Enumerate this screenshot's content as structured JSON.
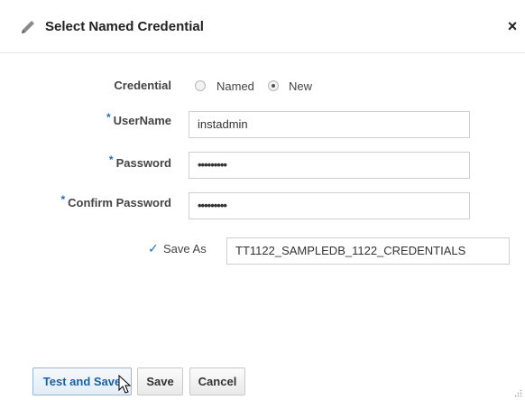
{
  "dialog": {
    "title": "Select Named Credential",
    "close_label": "×"
  },
  "form": {
    "credential": {
      "label": "Credential",
      "options": [
        "Named",
        "New"
      ],
      "selected": "New"
    },
    "username": {
      "label": "UserName",
      "required_mark": "*",
      "value": "instadmin"
    },
    "password": {
      "label": "Password",
      "required_mark": "*",
      "value": "•••••••••"
    },
    "confirm_password": {
      "label": "Confirm Password",
      "required_mark": "*",
      "value": "•••••••••"
    },
    "save_as": {
      "check": "✓",
      "label": "Save As",
      "value": "TT1122_SAMPLEDB_1122_CREDENTIALS"
    }
  },
  "buttons": {
    "test_and_save": "Test and Save",
    "save": "Save",
    "cancel": "Cancel"
  },
  "icons": {
    "title": "pencil-icon",
    "close": "close-icon",
    "cursor": "mouse-pointer-icon",
    "resize": "resize-grip-icon"
  },
  "colors": {
    "required_asterisk": "#1f6fb6",
    "primary_button_text": "#1f5fa4"
  }
}
